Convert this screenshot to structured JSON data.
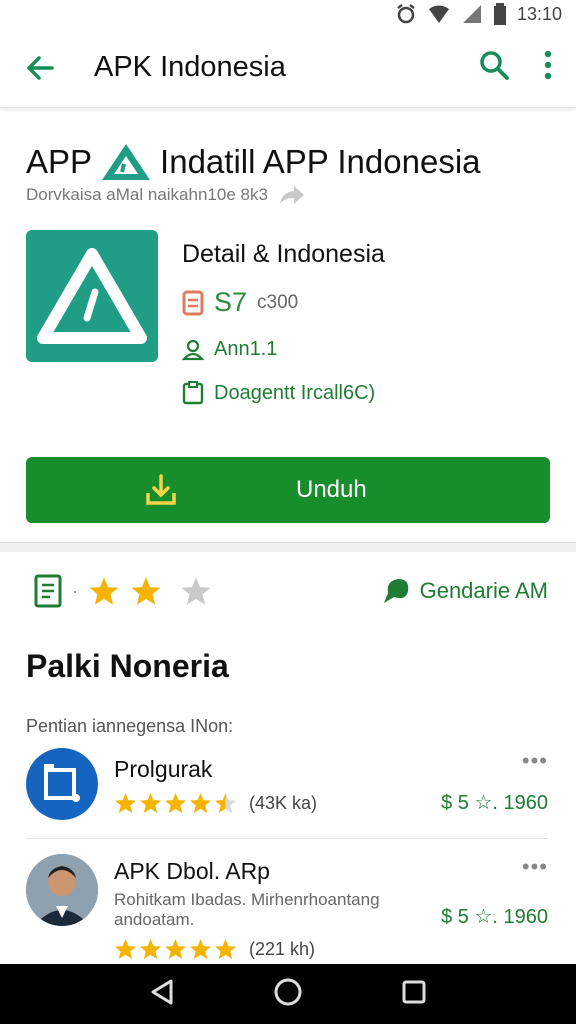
{
  "status_bar": {
    "time": "13:10",
    "icons": [
      "alarm-icon",
      "signal-icon",
      "battery-icon"
    ]
  },
  "app_bar": {
    "title": "APK Indonesia",
    "icons": [
      "back-arrow-icon",
      "search-icon",
      "more-vert-icon"
    ]
  },
  "header": {
    "headline_prefix": "APP",
    "headline_suffix": "Indatill APP Indonesia",
    "subtitle": "Dorvkaisa aMal naikahn10e 8k3"
  },
  "app": {
    "detail_title": "Detail & Indonesia",
    "price": "S7",
    "price_secondary": "c300",
    "author": "Ann1.1",
    "document": "Doagentt Ircall6C)",
    "download_label": "Unduh",
    "accent": "#1f9e85",
    "button_color": "#188d2c"
  },
  "rating_row": {
    "stars_filled": 2,
    "stars_total": 3,
    "right_label": "Gendarie AM"
  },
  "section": {
    "title": "Palki Noneria",
    "subtitle": "Pentian iannegensa INon:"
  },
  "list": [
    {
      "name": "Prolgurak",
      "description": "",
      "rating": 4.5,
      "count": "(43K ka)",
      "price": "$ 5 ☆. 1960",
      "avatar": "blue-app-icon"
    },
    {
      "name": "APK Dbol. ARp",
      "description": "Rohitkam Ibadas. Mirhenrhoantang andoatam.",
      "rating": 5,
      "count": "(221 kh)",
      "price": "$ 5 ☆. 1960",
      "avatar": "user-photo"
    }
  ],
  "nav_bar": {
    "icons": [
      "back-triangle-icon",
      "home-circle-icon",
      "recents-square-icon"
    ]
  }
}
